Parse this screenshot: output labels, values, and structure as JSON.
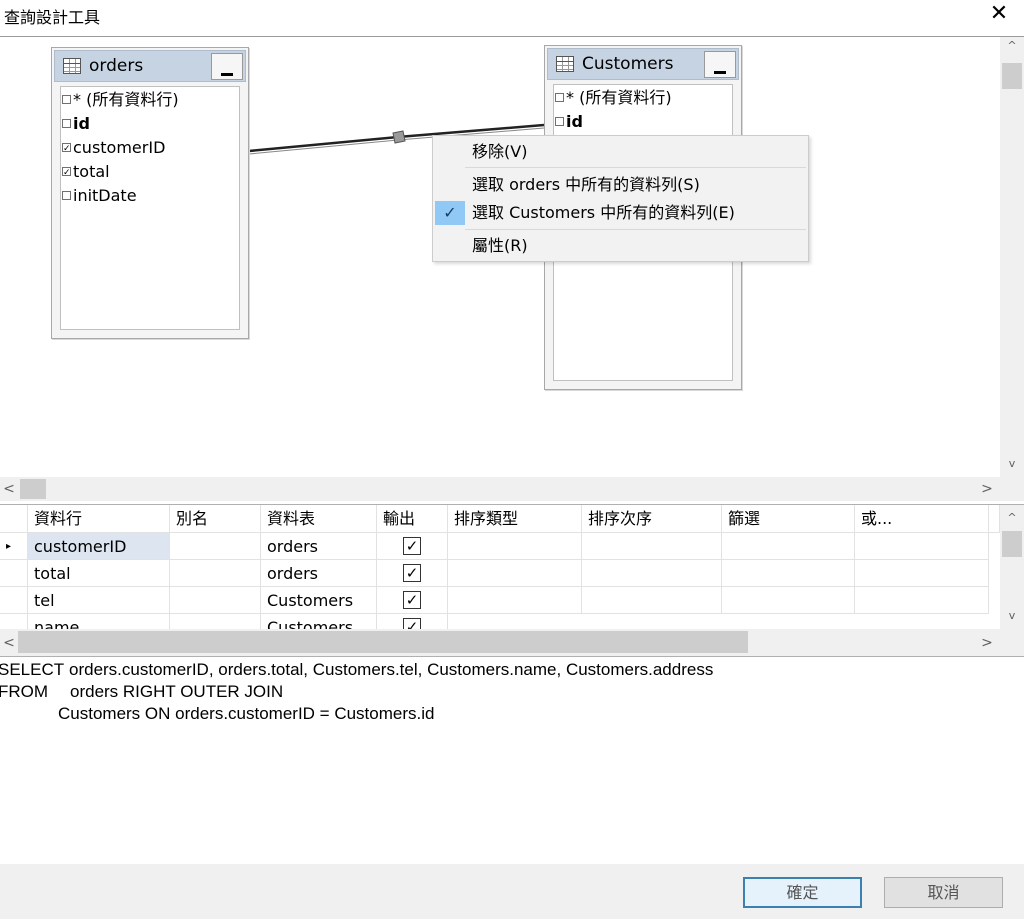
{
  "window": {
    "title": "查詢設計工具",
    "close_glyph": "✕"
  },
  "diagram": {
    "tables": [
      {
        "name": "orders",
        "columns": [
          {
            "label": "* (所有資料行)",
            "checked": false,
            "bold": false
          },
          {
            "label": "id",
            "checked": false,
            "bold": true
          },
          {
            "label": "customerID",
            "checked": true,
            "bold": false
          },
          {
            "label": "total",
            "checked": true,
            "bold": false
          },
          {
            "label": "initDate",
            "checked": false,
            "bold": false
          }
        ]
      },
      {
        "name": "Customers",
        "columns": [
          {
            "label": "* (所有資料行)",
            "checked": false,
            "bold": false
          },
          {
            "label": "id",
            "checked": false,
            "bold": true
          }
        ]
      }
    ]
  },
  "context_menu": {
    "items": [
      {
        "label": "移除(V)",
        "checked": false
      },
      {
        "label": "選取 orders 中所有的資料列(S)",
        "checked": false
      },
      {
        "label": "選取 Customers 中所有的資料列(E)",
        "checked": true
      },
      {
        "label": "屬性(R)",
        "checked": false
      }
    ]
  },
  "grid": {
    "headers": [
      "資料行",
      "別名",
      "資料表",
      "輸出",
      "排序類型",
      "排序次序",
      "篩選",
      "或..."
    ],
    "rows": [
      {
        "column": "customerID",
        "alias": "",
        "table": "orders",
        "output": true,
        "selected": true
      },
      {
        "column": "total",
        "alias": "",
        "table": "orders",
        "output": true,
        "selected": false
      },
      {
        "column": "tel",
        "alias": "",
        "table": "Customers",
        "output": true,
        "selected": false
      },
      {
        "column": "name",
        "alias": "",
        "table": "Customers",
        "output": true,
        "selected": false
      }
    ]
  },
  "sql": {
    "line1_kw": "SELECT",
    "line1": "orders.customerID, orders.total, Customers.tel, Customers.name, Customers.address",
    "line2_kw": "FROM",
    "line2": "orders RIGHT OUTER JOIN",
    "line3": "Customers ON orders.customerID = Customers.id"
  },
  "buttons": {
    "ok": "確定",
    "cancel": "取消"
  },
  "scroll": {
    "left": "<",
    "right": ">",
    "up": "^",
    "down": "v"
  }
}
